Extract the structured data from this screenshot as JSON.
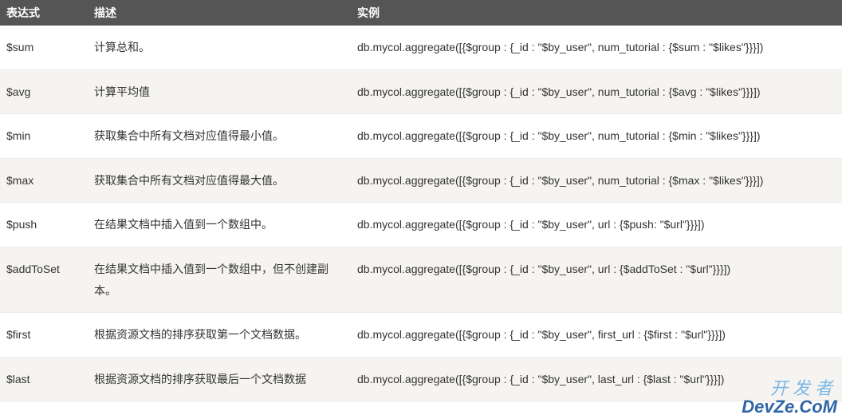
{
  "table": {
    "headers": [
      "表达式",
      "描述",
      "实例"
    ],
    "rows": [
      {
        "expr": "$sum",
        "desc": "计算总和。",
        "example": "db.mycol.aggregate([{$group : {_id : \"$by_user\", num_tutorial : {$sum : \"$likes\"}}}])"
      },
      {
        "expr": "$avg",
        "desc": "计算平均值",
        "example": "db.mycol.aggregate([{$group : {_id : \"$by_user\", num_tutorial : {$avg : \"$likes\"}}}])"
      },
      {
        "expr": "$min",
        "desc": "获取集合中所有文档对应值得最小值。",
        "example": "db.mycol.aggregate([{$group : {_id : \"$by_user\", num_tutorial : {$min : \"$likes\"}}}])"
      },
      {
        "expr": "$max",
        "desc": "获取集合中所有文档对应值得最大值。",
        "example": "db.mycol.aggregate([{$group : {_id : \"$by_user\", num_tutorial : {$max : \"$likes\"}}}])"
      },
      {
        "expr": "$push",
        "desc": "在结果文档中插入值到一个数组中。",
        "example": "db.mycol.aggregate([{$group : {_id : \"$by_user\", url : {$push: \"$url\"}}}])"
      },
      {
        "expr": "$addToSet",
        "desc": "在结果文档中插入值到一个数组中，但不创建副本。",
        "example": "db.mycol.aggregate([{$group : {_id : \"$by_user\", url : {$addToSet : \"$url\"}}}])"
      },
      {
        "expr": "$first",
        "desc": "根据资源文档的排序获取第一个文档数据。",
        "example": "db.mycol.aggregate([{$group : {_id : \"$by_user\", first_url : {$first : \"$url\"}}}])"
      },
      {
        "expr": "$last",
        "desc": "根据资源文档的排序获取最后一个文档数据",
        "example": "db.mycol.aggregate([{$group : {_id : \"$by_user\", last_url : {$last : \"$url\"}}}])"
      }
    ]
  },
  "watermark": {
    "cn": "开发者",
    "en": "DevZe.CoM"
  }
}
